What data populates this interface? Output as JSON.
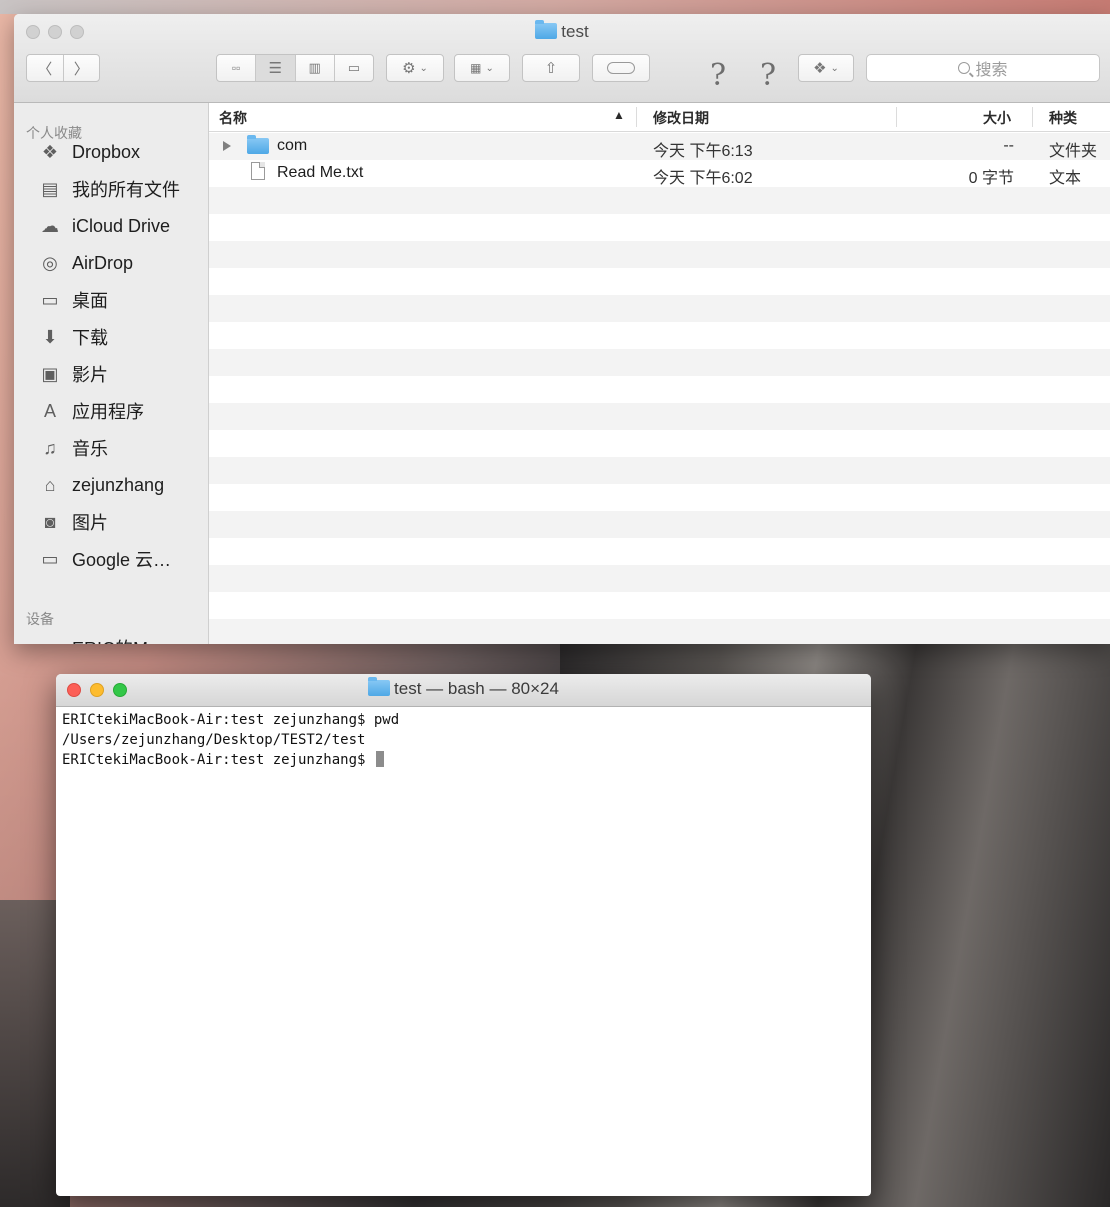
{
  "finder": {
    "title": "test",
    "search_placeholder": "搜索",
    "sidebar": {
      "favorites_header": "个人收藏",
      "favorites": [
        {
          "label": "Dropbox",
          "icon": "dropbox-icon"
        },
        {
          "label": "我的所有文件",
          "icon": "all-files-icon"
        },
        {
          "label": "iCloud Drive",
          "icon": "cloud-icon"
        },
        {
          "label": "AirDrop",
          "icon": "airdrop-icon"
        },
        {
          "label": "桌面",
          "icon": "desktop-icon"
        },
        {
          "label": "下载",
          "icon": "downloads-icon"
        },
        {
          "label": "影片",
          "icon": "movies-icon"
        },
        {
          "label": "应用程序",
          "icon": "applications-icon"
        },
        {
          "label": "音乐",
          "icon": "music-icon"
        },
        {
          "label": "zejunzhang",
          "icon": "home-icon"
        },
        {
          "label": "图片",
          "icon": "pictures-icon"
        },
        {
          "label": "Google 云…",
          "icon": "folder-icon"
        }
      ],
      "devices_header": "设备",
      "devices": [
        {
          "label": "ERIC的Ma…",
          "icon": "laptop-icon"
        }
      ]
    },
    "columns": {
      "name": "名称",
      "date": "修改日期",
      "size": "大小",
      "kind": "种类"
    },
    "files": [
      {
        "name": "com",
        "date": "今天 下午6:13",
        "size": "--",
        "kind": "文件夹",
        "type": "folder"
      },
      {
        "name": "Read Me.txt",
        "date": "今天 下午6:02",
        "size": "0 字节",
        "kind": "文本",
        "type": "text"
      }
    ]
  },
  "terminal": {
    "title": "test — bash — 80×24",
    "lines": [
      "ERICtekiMacBook-Air:test zejunzhang$ pwd",
      "/Users/zejunzhang/Desktop/TEST2/test",
      "ERICtekiMacBook-Air:test zejunzhang$ "
    ]
  },
  "colors": {
    "close": "#fc5f57",
    "minimize": "#fdbc2e",
    "zoom": "#33c748",
    "folder": "#5aaeea"
  }
}
